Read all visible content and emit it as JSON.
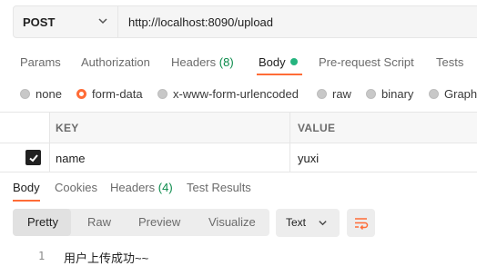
{
  "request": {
    "method": "POST",
    "url": "http://localhost:8090/upload"
  },
  "request_tabs": {
    "params": "Params",
    "authorization": "Authorization",
    "headers": "Headers",
    "headers_count": "(8)",
    "body": "Body",
    "pre_request_script": "Pre-request Script",
    "tests": "Tests"
  },
  "body_types": {
    "none": "none",
    "form_data": "form-data",
    "urlencoded": "x-www-form-urlencoded",
    "raw": "raw",
    "binary": "binary",
    "graphql": "GraphQL"
  },
  "table": {
    "key_header": "KEY",
    "value_header": "VALUE",
    "rows": [
      {
        "key": "name",
        "value": "yuxi",
        "checked": true
      }
    ]
  },
  "response_tabs": {
    "body": "Body",
    "cookies": "Cookies",
    "headers": "Headers",
    "headers_count": "(4)",
    "test_results": "Test Results"
  },
  "format": {
    "pretty": "Pretty",
    "raw": "Raw",
    "preview": "Preview",
    "visualize": "Visualize",
    "type": "Text"
  },
  "response": {
    "line_number": "1",
    "text": "用户上传成功~~"
  },
  "colors": {
    "accent": "#ff6c37",
    "body_dot": "#26b47f",
    "count_green": "#0a8a4a"
  }
}
